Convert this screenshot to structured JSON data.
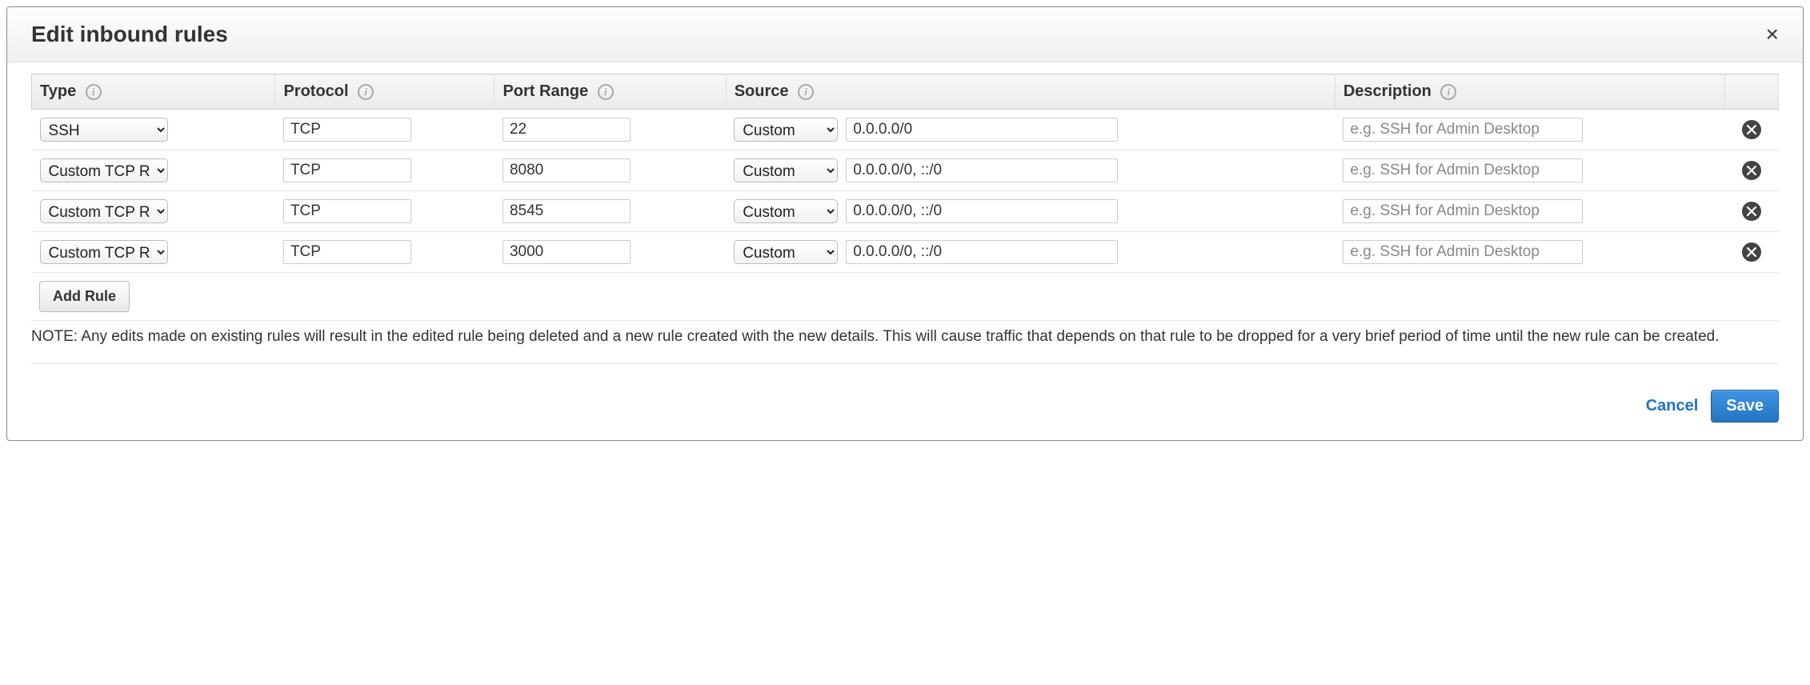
{
  "dialog": {
    "title": "Edit inbound rules",
    "close_label": "×"
  },
  "columns": {
    "type": "Type",
    "protocol": "Protocol",
    "port_range": "Port Range",
    "source": "Source",
    "description": "Description"
  },
  "description_placeholder": "e.g. SSH for Admin Desktop",
  "rules": [
    {
      "type": "SSH",
      "protocol": "TCP",
      "port_range": "22",
      "source_mode": "Custom",
      "source_value": "0.0.0.0/0",
      "description": ""
    },
    {
      "type": "Custom TCP Rule",
      "protocol": "TCP",
      "port_range": "8080",
      "source_mode": "Custom",
      "source_value": "0.0.0.0/0, ::/0",
      "description": ""
    },
    {
      "type": "Custom TCP Rule",
      "protocol": "TCP",
      "port_range": "8545",
      "source_mode": "Custom",
      "source_value": "0.0.0.0/0, ::/0",
      "description": ""
    },
    {
      "type": "Custom TCP Rule",
      "protocol": "TCP",
      "port_range": "3000",
      "source_mode": "Custom",
      "source_value": "0.0.0.0/0, ::/0",
      "description": ""
    }
  ],
  "buttons": {
    "add_rule": "Add Rule",
    "cancel": "Cancel",
    "save": "Save"
  },
  "note": "NOTE: Any edits made on existing rules will result in the edited rule being deleted and a new rule created with the new details. This will cause traffic that depends on that rule to be dropped for a very brief period of time until the new rule can be created."
}
